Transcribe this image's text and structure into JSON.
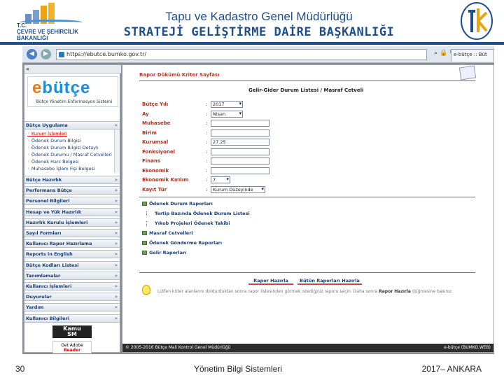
{
  "slide": {
    "logo_left_text": [
      "T.C.",
      "ÇEVRE VE ŞEHİRCİLİK",
      "BAKANLIĞI"
    ],
    "title_line1": "Tapu ve Kadastro Genel Müdürlüğü",
    "title_line2": "STRATEJİ GELİŞTİRME DAİRE BAŞKANLIĞI",
    "page_number": "30",
    "footer_center": "Yönetim Bilgi Sistemleri",
    "footer_right": "2017– ANKARA",
    "accent_color": "#1f4e8c"
  },
  "browser": {
    "address": "https://ebutce.bumko.gov.tr/",
    "tab_label": "e-bütçe :: Büt",
    "icons": [
      "back-icon",
      "forward-icon",
      "search-icon",
      "refresh-icon",
      "home-icon",
      "star-icon",
      "gear-icon"
    ]
  },
  "sidebar": {
    "toggle": "«",
    "logo_main": "e",
    "logo_rest": "bütçe",
    "logo_sub": "Bütçe Yönetim Enformasyon Sistemi",
    "open_menu": "Bütçe Uygulama",
    "submenu": [
      "Kurum İşlemleri",
      "Ödenek Durum Bilgisi",
      "Ödenek Durum Bilgisi Detaylı",
      "Ödenek Durumu / Masraf Cetvelleri",
      "Ödenek Harc Belgesi",
      "Muhasebe İşlem Fişi Belgesi"
    ],
    "menus": [
      "Bütçe Hazırlık",
      "Performans Bütçe",
      "Personel Bilgileri",
      "Hesap ve Yük Hazırlık",
      "Hazırlık Kurulu İşlemleri",
      "Sayıl Formları",
      "Kullanıcı Rapor Hazırlama",
      "Reports in English",
      "Bütçe Kodları Listesi",
      "Tanımlamalar",
      "Kullanıcı İşlemleri",
      "Duyurular",
      "Yardım",
      "Kullanıcı Bilgileri"
    ],
    "badge_kamu_1": "Kamu",
    "badge_kamu_2": "SM",
    "badge_adobe_1": "Get Adobe",
    "badge_adobe_2": "Reader"
  },
  "main": {
    "page_title": "Rapor Dökümü Kriter Sayfası",
    "report_title": "Gelir-Gider Durum Listesi / Masraf Cetveli",
    "fields": [
      {
        "label": "Bütçe Yılı",
        "value": "2017",
        "type": "select"
      },
      {
        "label": "Ay",
        "value": "Nisan",
        "type": "select"
      },
      {
        "label": "Muhasebe",
        "value": "",
        "type": "text"
      },
      {
        "label": "Birim",
        "value": "",
        "type": "text"
      },
      {
        "label": "Kurumsal",
        "value": "27.25",
        "type": "text"
      },
      {
        "label": "Fonksiyonel",
        "value": "",
        "type": "text"
      },
      {
        "label": "Finans",
        "value": "",
        "type": "text"
      },
      {
        "label": "Ekonomik",
        "value": "",
        "type": "text"
      },
      {
        "label": "Ekonomik Kırılım",
        "value": "7",
        "type": "select"
      },
      {
        "label": "Kayıt Tür",
        "value": "Kurum Düzeyinde",
        "type": "select"
      }
    ],
    "tree": [
      {
        "label": "Ödenek Durum Raporları",
        "level": 0
      },
      {
        "label": "Tertip Bazında Ödenek Durum Listesi",
        "level": 1
      },
      {
        "label": "Yıkob Projeleri Ödenek Takibi",
        "level": 1
      },
      {
        "label": "Masraf Cetvelleri",
        "level": 0
      },
      {
        "label": "Ödenek Gönderme Raporları",
        "level": 0
      },
      {
        "label": "Gelir Raporları",
        "level": 0
      }
    ],
    "btn_report": "Rapor Hazırla",
    "btn_all": "Bütün Raporları Hazırla",
    "hint_prefix": "Lütfen kriter alanlarını doldurduktan sonra rapor listesinden görmek istediğiniz raporu seçin. Daha sonra",
    "hint_bold": "Rapor Hazırla",
    "hint_suffix": "düğmesine basınız.",
    "footer_left": "© 2005-2016 Bütçe Mali Kontrol Genel Müdürlüğü",
    "footer_right": "e-bütçe (BUMKO.WEB)"
  }
}
